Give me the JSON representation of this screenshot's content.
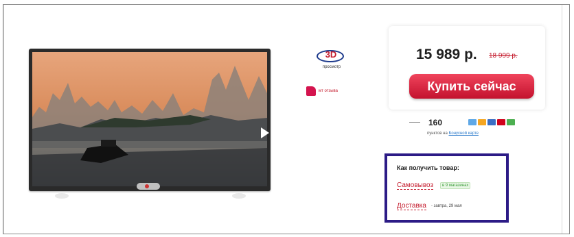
{
  "product": {
    "badge_3d": "3D",
    "badge_3d_sub": "просмотр",
    "like_label": "мт отзыва",
    "price": "15 989 р.",
    "old_price": "18 999 р.",
    "buy_label": "Купить сейчас",
    "count": "160",
    "stores_text": "пунктов на",
    "stores_link": "Бонусной карте"
  },
  "delivery": {
    "title": "Как получить товар:",
    "pickup": "Самовывоз",
    "pickup_tag": "в 9 магазинах",
    "delivery": "Доставка",
    "delivery_note": "- завтра, 29 мая"
  },
  "colors": {
    "accent_red": "#c41a2c",
    "frame_border": "#2c1b86"
  }
}
